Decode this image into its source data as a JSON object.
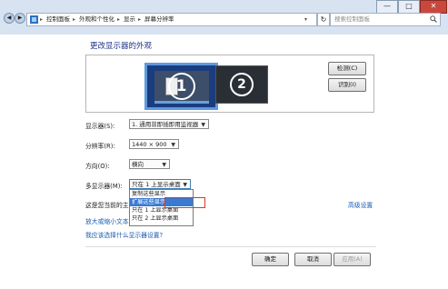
{
  "window": {
    "controls": [
      "—",
      "□",
      "✕"
    ]
  },
  "address_bar": {
    "crumbs": [
      "控制面板",
      "外观和个性化",
      "显示",
      "屏幕分辨率"
    ],
    "search_placeholder": "搜索控制面板"
  },
  "main": {
    "title": "更改显示器的外观",
    "detect_button": "检测(C)",
    "identify_button": "识别(I)",
    "monitor_numbers": [
      "1",
      "2"
    ]
  },
  "settings": {
    "display_label": "显示器(S):",
    "display_value": "1. 通用非即插即用监视器",
    "resolution_label": "分辨率(R):",
    "resolution_value": "1440 × 900",
    "orientation_label": "方向(O):",
    "orientation_value": "横向",
    "multi_label": "多显示器(M):",
    "multi_value": "只在 1 上显示桌面",
    "current_label": "这是您当前的主",
    "advanced_link": "高级设置",
    "enlarge_link": "放大或缩小文本",
    "which_link": "我应该选择什么显示器设置?"
  },
  "dropdown": {
    "options": [
      "复制这些显示",
      "扩展这些显示",
      "只在 1 上显示桌面",
      "只在 2 上显示桌面"
    ]
  },
  "footer": {
    "ok": "确定",
    "cancel": "取消",
    "apply": "应用(A)"
  }
}
